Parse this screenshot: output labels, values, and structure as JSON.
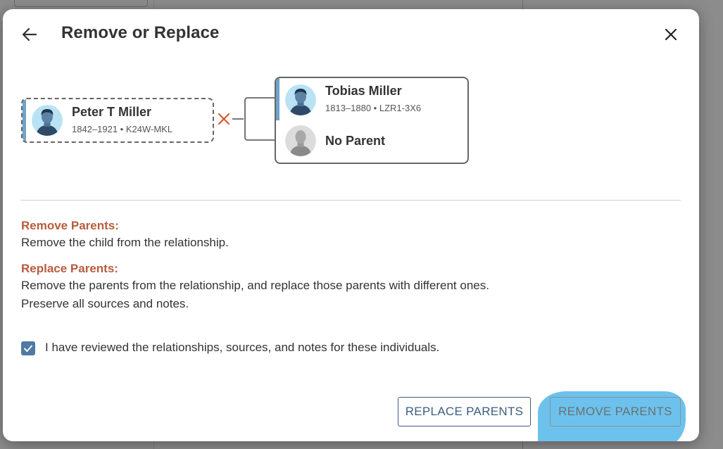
{
  "dialog": {
    "title": "Remove or Replace",
    "back_icon": "arrow-left-icon",
    "close_icon": "close-icon"
  },
  "child": {
    "name": "Peter T Miller",
    "meta": "1842–1921 • K24W-MKL",
    "avatar_icon": "male-avatar-icon"
  },
  "parents": {
    "father": {
      "name": "Tobias Miller",
      "meta": "1813–1880 • LZR1-3X6",
      "avatar_icon": "male-avatar-icon"
    },
    "other": {
      "name": "No Parent",
      "avatar_icon": "unknown-avatar-icon"
    }
  },
  "sections": {
    "remove_label": "Remove Parents:",
    "remove_text": "Remove the child from the relationship.",
    "replace_label": "Replace Parents:",
    "replace_text_1": "Remove the parents from the relationship, and replace those parents with different ones.",
    "replace_text_2": "Preserve all sources and notes."
  },
  "confirm": {
    "checked": true,
    "label": "I have reviewed the relationships, sources, and notes for these individuals."
  },
  "buttons": {
    "replace": "REPLACE PARENTS",
    "remove": "REMOVE PARENTS"
  },
  "colors": {
    "accent_blue": "#6fa3c9",
    "label_orange": "#b85c3d",
    "checkbox_blue": "#4e7aa3",
    "button_outline": "#3d5d7e",
    "highlight": "#6cc2ec",
    "remove_x": "#d9572b"
  }
}
